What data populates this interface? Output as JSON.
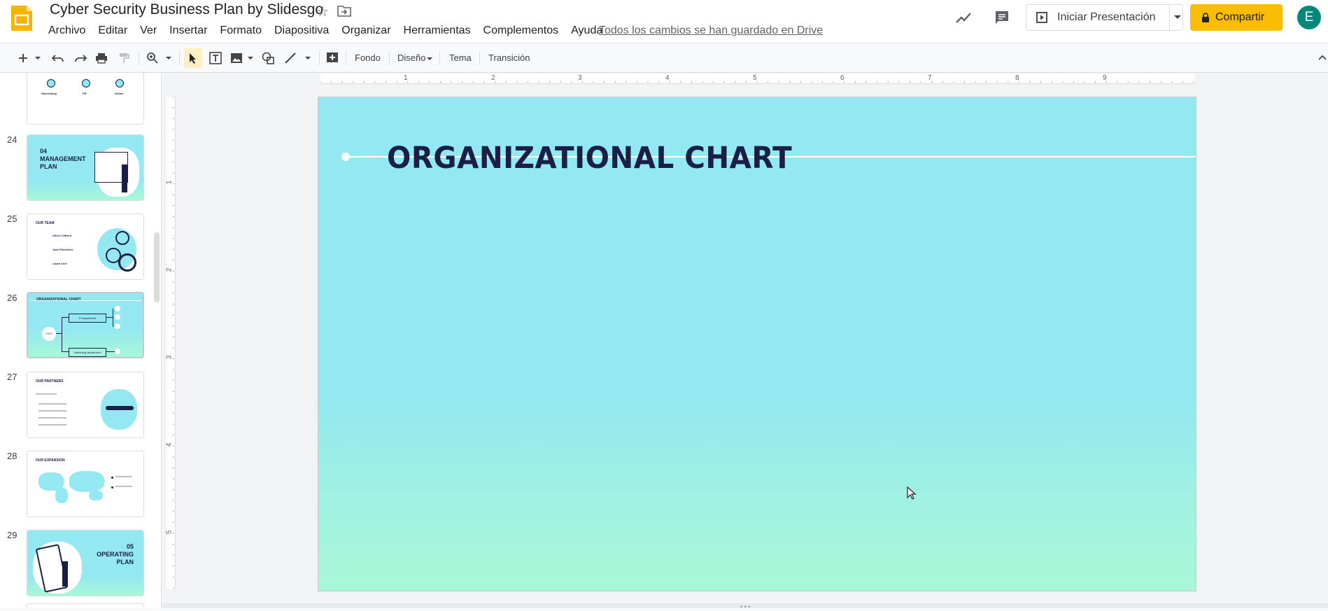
{
  "app": {
    "doc_title": "Cyber Security Business Plan by Slidesgo",
    "save_status": "Todos los cambios se han guardado en Drive",
    "menu": [
      "Archivo",
      "Editar",
      "Ver",
      "Insertar",
      "Formato",
      "Diapositiva",
      "Organizar",
      "Herramientas",
      "Complementos",
      "Ayuda"
    ],
    "present_label": "Iniciar Presentación",
    "share_label": "Compartir",
    "avatar_letter": "E",
    "colors": {
      "share": "#fbbc04",
      "avatar": "#00897b",
      "accent": "#1b1f48"
    }
  },
  "toolbar": {
    "background": "Fondo",
    "layout": "Diseño",
    "theme": "Tema",
    "transition": "Transición",
    "icons": [
      "new-slide-icon",
      "undo-icon",
      "redo-icon",
      "print-icon",
      "paint-format-icon",
      "zoom-icon",
      "select-icon",
      "textbox-icon",
      "image-icon",
      "shape-icon",
      "line-icon",
      "comment-add-icon"
    ]
  },
  "filmstrip": {
    "slides": [
      {
        "num": "24",
        "title_line1": "04",
        "title_line2": "MANAGEMENT",
        "title_line3": "PLAN"
      },
      {
        "num": "25",
        "title": "OUR TEAM",
        "names": [
          "Albert Clifford",
          "Jane Pilchester",
          "Laura Chel"
        ]
      },
      {
        "num": "26",
        "title": "ORGANIZATIONAL CHART",
        "ceo": "CEO",
        "boxes": [
          "IT department",
          "Marketing department"
        ]
      },
      {
        "num": "27",
        "title": "OUR PARTNERS"
      },
      {
        "num": "28",
        "title": "OUR EXPANSION"
      },
      {
        "num": "29",
        "title_line1": "05",
        "title_line2": "OPERATING",
        "title_line3": "PLAN"
      }
    ],
    "top_partial_labels": [
      "Advertising",
      "PR",
      "Online"
    ]
  },
  "ruler": {
    "h": [
      "1",
      "2",
      "3",
      "4",
      "5",
      "6",
      "7",
      "8",
      "9"
    ],
    "v": [
      "1",
      "2",
      "3",
      "4",
      "5"
    ]
  },
  "slide": {
    "title": "ORGANIZATIONAL CHART"
  }
}
